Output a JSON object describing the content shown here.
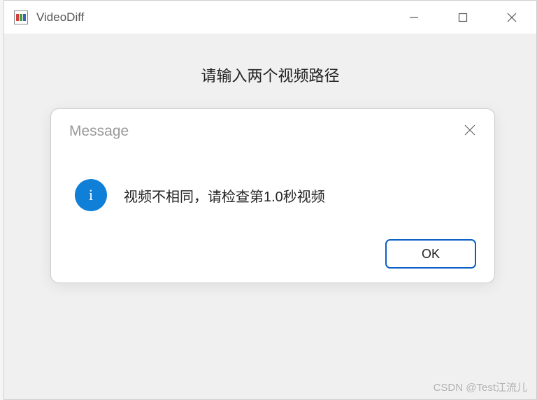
{
  "window": {
    "title": "VideoDiff"
  },
  "content": {
    "heading": "请输入两个视频路径"
  },
  "dialog": {
    "title": "Message",
    "icon": "info",
    "icon_glyph": "i",
    "message": "视频不相同，请检查第1.0秒视频",
    "ok_label": "OK"
  },
  "watermark": "CSDN @Test江流儿"
}
